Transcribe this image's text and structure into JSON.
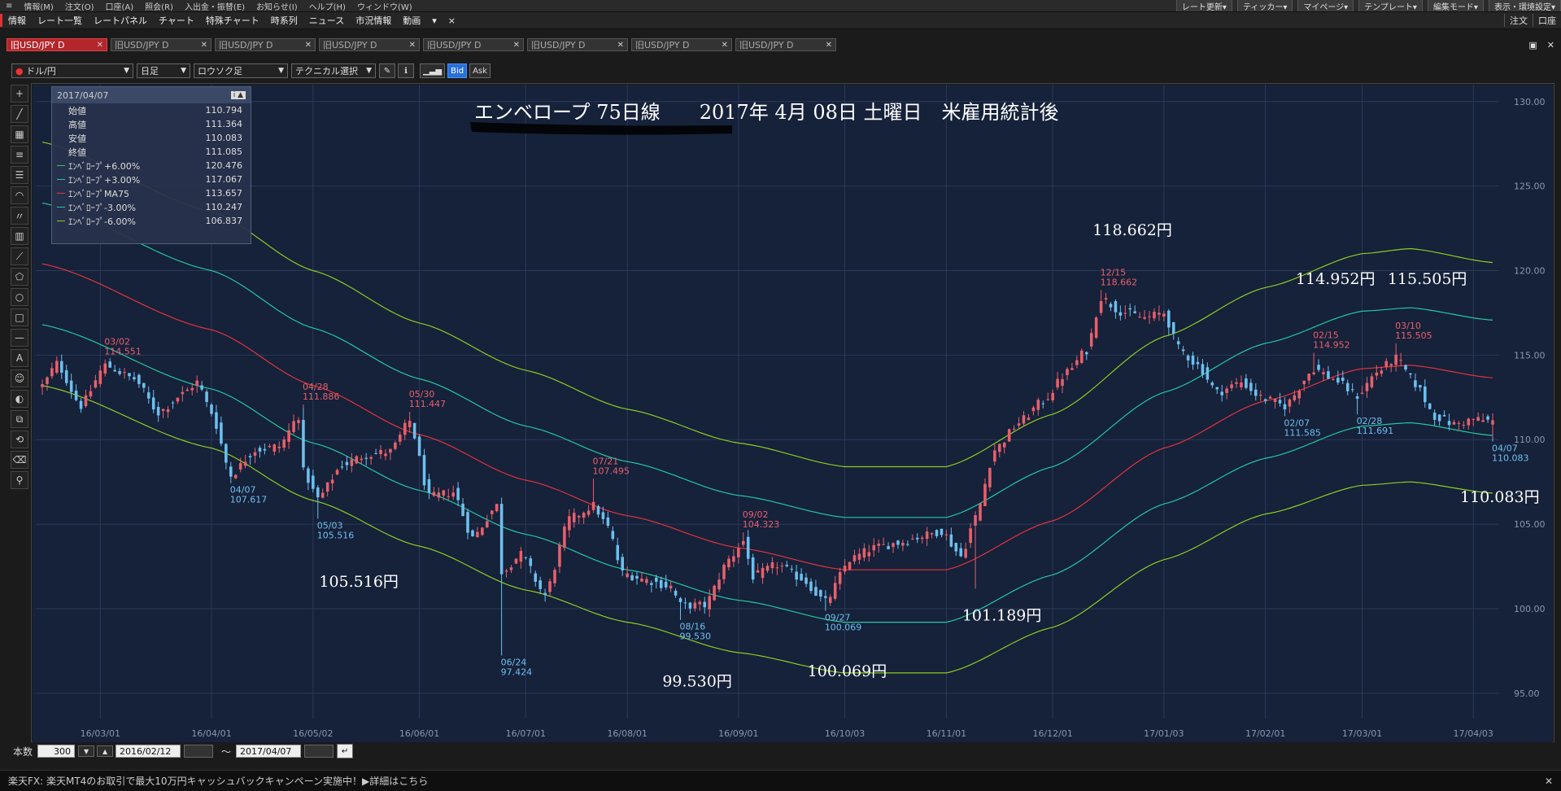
{
  "topbar": {
    "menus": [
      "情報(M)",
      "注文(O)",
      "口座(A)",
      "照会(R)",
      "入出金・振替(E)",
      "お知らせ(I)",
      "ヘルプ(H)",
      "ウィンドウ(W)"
    ],
    "right_buttons": [
      "レート更新▾",
      "ティッカー▾",
      "マイページ▾",
      "テンプレート▾",
      "編集モード▾",
      "表示・環境設定▾"
    ]
  },
  "menubar": {
    "items": [
      "情報",
      "レート一覧",
      "レートパネル",
      "チャート",
      "特殊チャート",
      "時系列",
      "ニュース",
      "市況情報",
      "動画",
      "▾",
      "×"
    ],
    "right": [
      "注文",
      "口座"
    ]
  },
  "tabs": [
    {
      "label": "旧USD/JPY D",
      "active": true
    },
    {
      "label": "旧USD/JPY D",
      "active": false
    },
    {
      "label": "旧USD/JPY D",
      "active": false
    },
    {
      "label": "旧USD/JPY D",
      "active": false
    },
    {
      "label": "旧USD/JPY D",
      "active": false
    },
    {
      "label": "旧USD/JPY D",
      "active": false
    },
    {
      "label": "旧USD/JPY D",
      "active": false
    },
    {
      "label": "旧USD/JPY D",
      "active": false
    }
  ],
  "toolbar": {
    "pair": "ドル/円",
    "period": "日足",
    "chart_type": "ロウソク足",
    "technical": "テクニカル選択",
    "bid": "Bid",
    "ask": "Ask"
  },
  "left_tools": [
    "+",
    "╱",
    "▦",
    "≡",
    "☰",
    "◠",
    "〃",
    "▥",
    "⟋",
    "⬠",
    "○",
    "□",
    "—",
    "A",
    "☺",
    "◐",
    "⧉",
    "⟲",
    "⌫",
    "⚲"
  ],
  "infobox": {
    "date": "2017/04/07",
    "rows": [
      {
        "label": "始値",
        "value": "110.794",
        "color": ""
      },
      {
        "label": "高値",
        "value": "111.364",
        "color": ""
      },
      {
        "label": "安値",
        "value": "110.083",
        "color": ""
      },
      {
        "label": "終値",
        "value": "111.085",
        "color": ""
      },
      {
        "label": "ｴﾝﾍﾞﾛｰﾌﾟ+6.00%",
        "value": "120.476",
        "color": "#2fc46f"
      },
      {
        "label": "ｴﾝﾍﾞﾛｰﾌﾟ+3.00%",
        "value": "117.067",
        "color": "#22c8a0"
      },
      {
        "label": "ｴﾝﾍﾞﾛｰﾌﾟMA75",
        "value": "113.657",
        "color": "#e0343c"
      },
      {
        "label": "ｴﾝﾍﾞﾛｰﾌﾟ-3.00%",
        "value": "110.247",
        "color": "#22c8a0"
      },
      {
        "label": "ｴﾝﾍﾞﾛｰﾌﾟ-6.00%",
        "value": "106.837",
        "color": "#8ccc22"
      }
    ]
  },
  "chart_data": {
    "type": "candlestick",
    "title": "エンベロープ 75日線　　2017年 4月 08日 土曜日　米雇用統計後",
    "ylim": [
      93.5,
      131.0
    ],
    "yticks": [
      "130.00",
      "125.00",
      "120.00",
      "115.00",
      "110.00",
      "105.00",
      "100.00",
      "95.00"
    ],
    "xticks": [
      "16/03/01",
      "16/04/01",
      "16/05/02",
      "16/06/01",
      "16/07/01",
      "16/08/01",
      "16/09/01",
      "16/10/03",
      "16/11/01",
      "16/12/01",
      "17/01/03",
      "17/02/01",
      "17/03/01",
      "17/04/03"
    ],
    "date_range": [
      "2016/02/12",
      "2017/04/07"
    ],
    "bars": 300,
    "close_anchors": [
      [
        "2016/02/12",
        113.2
      ],
      [
        "2016/02/17",
        114.5
      ],
      [
        "2016/02/24",
        112.0
      ],
      [
        "2016/03/02",
        114.4
      ],
      [
        "2016/03/10",
        113.6
      ],
      [
        "2016/03/17",
        111.6
      ],
      [
        "2016/03/24",
        112.7
      ],
      [
        "2016/03/29",
        113.4
      ],
      [
        "2016/04/01",
        111.6
      ],
      [
        "2016/04/07",
        107.9
      ],
      [
        "2016/04/14",
        109.4
      ],
      [
        "2016/04/21",
        109.6
      ],
      [
        "2016/04/27",
        111.4
      ],
      [
        "2016/04/28",
        108.1
      ],
      [
        "2016/05/03",
        106.5
      ],
      [
        "2016/05/10",
        108.5
      ],
      [
        "2016/05/17",
        109.1
      ],
      [
        "2016/05/24",
        109.3
      ],
      [
        "2016/05/30",
        111.1
      ],
      [
        "2016/06/03",
        106.6
      ],
      [
        "2016/06/10",
        106.9
      ],
      [
        "2016/06/16",
        104.2
      ],
      [
        "2016/06/23",
        106.1
      ],
      [
        "2016/06/24",
        102.2
      ],
      [
        "2016/06/30",
        103.2
      ],
      [
        "2016/07/07",
        100.8
      ],
      [
        "2016/07/14",
        105.3
      ],
      [
        "2016/07/21",
        106.1
      ],
      [
        "2016/07/26",
        104.8
      ],
      [
        "2016/07/29",
        102.1
      ],
      [
        "2016/08/05",
        101.7
      ],
      [
        "2016/08/12",
        101.3
      ],
      [
        "2016/08/16",
        100.2
      ],
      [
        "2016/08/23",
        100.2
      ],
      [
        "2016/08/30",
        102.9
      ],
      [
        "2016/09/02",
        104.0
      ],
      [
        "2016/09/06",
        101.9
      ],
      [
        "2016/09/13",
        102.6
      ],
      [
        "2016/09/20",
        101.8
      ],
      [
        "2016/09/27",
        100.4
      ],
      [
        "2016/10/04",
        102.9
      ],
      [
        "2016/10/11",
        103.6
      ],
      [
        "2016/10/18",
        103.9
      ],
      [
        "2016/10/25",
        104.3
      ],
      [
        "2016/10/31",
        104.6
      ],
      [
        "2016/11/04",
        103.1
      ],
      [
        "2016/11/09",
        105.4
      ],
      [
        "2016/11/15",
        109.4
      ],
      [
        "2016/11/22",
        111.0
      ],
      [
        "2016/11/29",
        112.3
      ],
      [
        "2016/12/06",
        114.0
      ],
      [
        "2016/12/12",
        115.3
      ],
      [
        "2016/12/15",
        118.4
      ],
      [
        "2016/12/21",
        117.6
      ],
      [
        "2016/12/28",
        117.2
      ],
      [
        "2017/01/03",
        117.5
      ],
      [
        "2017/01/06",
        115.4
      ],
      [
        "2017/01/12",
        114.4
      ],
      [
        "2017/01/18",
        112.8
      ],
      [
        "2017/01/25",
        113.4
      ],
      [
        "2017/01/31",
        112.5
      ],
      [
        "2017/02/07",
        112.0
      ],
      [
        "2017/02/15",
        114.2
      ],
      [
        "2017/02/21",
        113.6
      ],
      [
        "2017/02/28",
        112.6
      ],
      [
        "2017/03/06",
        114.0
      ],
      [
        "2017/03/10",
        114.8
      ],
      [
        "2017/03/16",
        113.3
      ],
      [
        "2017/03/22",
        111.4
      ],
      [
        "2017/03/28",
        110.9
      ],
      [
        "2017/04/03",
        111.2
      ],
      [
        "2017/04/07",
        111.085
      ]
    ],
    "envelope": {
      "ma75": [
        [
          "2016/02/12",
          120.4
        ],
        [
          "2016/04/01",
          116.5
        ],
        [
          "2016/05/02",
          113.2
        ],
        [
          "2016/06/01",
          110.3
        ],
        [
          "2016/07/01",
          107.6
        ],
        [
          "2016/08/01",
          105.5
        ],
        [
          "2016/09/01",
          103.6
        ],
        [
          "2016/10/03",
          102.3
        ],
        [
          "2016/11/01",
          102.3
        ],
        [
          "2016/12/01",
          105.2
        ],
        [
          "2017/01/03",
          109.5
        ],
        [
          "2017/02/01",
          112.3
        ],
        [
          "2017/03/01",
          114.2
        ],
        [
          "2017/03/15",
          114.4
        ],
        [
          "2017/04/07",
          113.657
        ]
      ],
      "upper6": [
        [
          "2016/02/12",
          127.6
        ],
        [
          "2016/04/01",
          123.5
        ],
        [
          "2016/05/02",
          120.0
        ],
        [
          "2016/06/01",
          116.9
        ],
        [
          "2016/07/01",
          114.1
        ],
        [
          "2016/08/01",
          111.8
        ],
        [
          "2016/09/01",
          109.8
        ],
        [
          "2016/10/03",
          108.4
        ],
        [
          "2016/11/01",
          108.4
        ],
        [
          "2016/12/01",
          111.5
        ],
        [
          "2017/01/03",
          116.1
        ],
        [
          "2017/02/01",
          119.0
        ],
        [
          "2017/03/01",
          121.0
        ],
        [
          "2017/03/15",
          121.3
        ],
        [
          "2017/04/07",
          120.476
        ]
      ],
      "upper3": [
        [
          "2016/02/12",
          124.0
        ],
        [
          "2016/04/01",
          120.0
        ],
        [
          "2016/05/02",
          116.6
        ],
        [
          "2016/06/01",
          113.6
        ],
        [
          "2016/07/01",
          110.8
        ],
        [
          "2016/08/01",
          108.7
        ],
        [
          "2016/09/01",
          106.7
        ],
        [
          "2016/10/03",
          105.4
        ],
        [
          "2016/11/01",
          105.4
        ],
        [
          "2016/12/01",
          108.4
        ],
        [
          "2017/01/03",
          112.8
        ],
        [
          "2017/02/01",
          115.7
        ],
        [
          "2017/03/01",
          117.6
        ],
        [
          "2017/03/15",
          117.8
        ],
        [
          "2017/04/07",
          117.067
        ]
      ],
      "lower3": [
        [
          "2016/02/12",
          116.8
        ],
        [
          "2016/04/01",
          113.0
        ],
        [
          "2016/05/02",
          109.8
        ],
        [
          "2016/06/01",
          107.0
        ],
        [
          "2016/07/01",
          104.4
        ],
        [
          "2016/08/01",
          102.3
        ],
        [
          "2016/09/01",
          100.5
        ],
        [
          "2016/10/03",
          99.2
        ],
        [
          "2016/11/01",
          99.2
        ],
        [
          "2016/12/01",
          102.0
        ],
        [
          "2017/01/03",
          106.2
        ],
        [
          "2017/02/01",
          108.9
        ],
        [
          "2017/03/01",
          110.8
        ],
        [
          "2017/03/15",
          111.0
        ],
        [
          "2017/04/07",
          110.247
        ]
      ],
      "lower6": [
        [
          "2016/02/12",
          113.2
        ],
        [
          "2016/04/01",
          109.5
        ],
        [
          "2016/05/02",
          106.4
        ],
        [
          "2016/06/01",
          103.7
        ],
        [
          "2016/07/01",
          101.1
        ],
        [
          "2016/08/01",
          99.2
        ],
        [
          "2016/09/01",
          97.4
        ],
        [
          "2016/10/03",
          96.2
        ],
        [
          "2016/11/01",
          96.2
        ],
        [
          "2016/12/01",
          98.9
        ],
        [
          "2017/01/03",
          102.9
        ],
        [
          "2017/02/01",
          105.6
        ],
        [
          "2017/03/01",
          107.3
        ],
        [
          "2017/03/15",
          107.5
        ],
        [
          "2017/04/07",
          106.837
        ]
      ]
    },
    "colors": {
      "up": "#e8606a",
      "down": "#6cc0ee",
      "ma": "#e0343c",
      "env3": "#22c8a0",
      "env6": "#8ccc22",
      "grid": "#2a3a5a",
      "bg": "#16213a"
    },
    "extremes": [
      {
        "date": "2016/03/02",
        "price": 114.551,
        "type": "high",
        "label1": "03/02",
        "label2": "114.551"
      },
      {
        "date": "2016/04/07",
        "price": 107.617,
        "type": "low",
        "label1": "04/07",
        "label2": "107.617"
      },
      {
        "date": "2016/04/28",
        "price": 111.886,
        "type": "high",
        "label1": "04/28",
        "label2": "111.886"
      },
      {
        "date": "2016/05/03",
        "price": 105.516,
        "type": "low",
        "label1": "05/03",
        "label2": "105.516"
      },
      {
        "date": "2016/05/30",
        "price": 111.447,
        "type": "high",
        "label1": "05/30",
        "label2": "111.447"
      },
      {
        "date": "2016/06/24",
        "price": 97.424,
        "type": "low",
        "label1": "06/24",
        "label2": "97.424"
      },
      {
        "date": "2016/07/21",
        "price": 107.495,
        "type": "high",
        "label1": "07/21",
        "label2": "107.495"
      },
      {
        "date": "2016/08/16",
        "price": 99.53,
        "type": "low",
        "label1": "08/16",
        "label2": "99.530"
      },
      {
        "date": "2016/09/02",
        "price": 104.323,
        "type": "high",
        "label1": "09/02",
        "label2": "104.323"
      },
      {
        "date": "2016/09/27",
        "price": 100.069,
        "type": "low",
        "label1": "09/27",
        "label2": "100.069"
      },
      {
        "date": "2016/11/09",
        "price": 101.189,
        "type": "low",
        "label1": "",
        "label2": ""
      },
      {
        "date": "2016/12/15",
        "price": 118.662,
        "type": "high",
        "label1": "12/15",
        "label2": "118.662"
      },
      {
        "date": "2017/02/07",
        "price": 111.585,
        "type": "low",
        "label1": "02/07",
        "label2": "111.585"
      },
      {
        "date": "2017/02/15",
        "price": 114.952,
        "type": "high",
        "label1": "02/15",
        "label2": "114.952"
      },
      {
        "date": "2017/02/28",
        "price": 111.691,
        "type": "low",
        "label1": "02/28",
        "label2": "111.691"
      },
      {
        "date": "2017/03/10",
        "price": 115.505,
        "type": "high",
        "label1": "03/10",
        "label2": "115.505"
      },
      {
        "date": "2017/04/07",
        "price": 110.083,
        "type": "low",
        "label1": "04/07",
        "label2": "110.083"
      }
    ],
    "annotations": [
      {
        "text": "105.516円",
        "date": "2016/05/12",
        "price": 101.3
      },
      {
        "text": "99.530円",
        "date": "2016/08/20",
        "price": 95.4
      },
      {
        "text": "100.069円",
        "date": "2016/10/01",
        "price": 96.0
      },
      {
        "text": "101.189円",
        "date": "2016/11/15",
        "price": 99.3
      },
      {
        "text": "118.662円",
        "date": "2016/12/22",
        "price": 122.1
      },
      {
        "text": "114.952円",
        "date": "2017/02/20",
        "price": 119.2
      },
      {
        "text": "115.505円",
        "date": "2017/03/19",
        "price": 119.2
      },
      {
        "text": "110.083円",
        "date": "2017/04/10",
        "price": 106.3
      }
    ]
  },
  "bottom": {
    "count_label": "本数",
    "count": "300",
    "from_date": "2016/02/12",
    "tilde": "～",
    "to_date": "2017/04/07"
  },
  "news": "楽天FX: 楽天MT4のお取引で最大10万円キャッシュバックキャンペーン実施中！▶詳細はこちら"
}
